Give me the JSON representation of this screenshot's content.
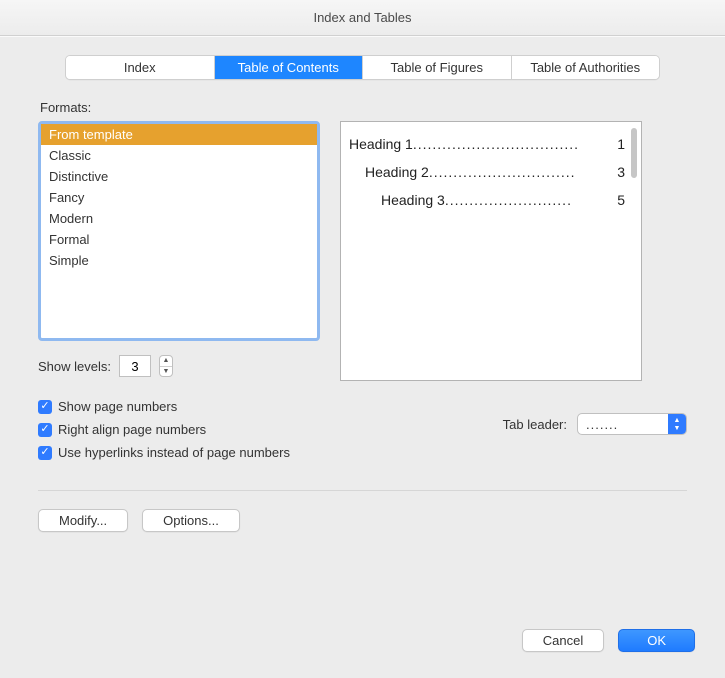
{
  "window": {
    "title": "Index and Tables"
  },
  "tabs": [
    {
      "label": "Index",
      "active": false
    },
    {
      "label": "Table of Contents",
      "active": true
    },
    {
      "label": "Table of Figures",
      "active": false
    },
    {
      "label": "Table of Authorities",
      "active": false
    }
  ],
  "formats": {
    "label": "Formats:",
    "items": [
      {
        "label": "From template",
        "selected": true
      },
      {
        "label": "Classic",
        "selected": false
      },
      {
        "label": "Distinctive",
        "selected": false
      },
      {
        "label": "Fancy",
        "selected": false
      },
      {
        "label": "Modern",
        "selected": false
      },
      {
        "label": "Formal",
        "selected": false
      },
      {
        "label": "Simple",
        "selected": false
      }
    ]
  },
  "preview": {
    "entries": [
      {
        "label": "Heading 1",
        "indent": 0,
        "page": "1"
      },
      {
        "label": "Heading 2",
        "indent": 1,
        "page": "3"
      },
      {
        "label": "Heading 3",
        "indent": 2,
        "page": "5"
      }
    ]
  },
  "show_levels": {
    "label": "Show levels:",
    "value": "3"
  },
  "checks": {
    "show_page_numbers": "Show page numbers",
    "right_align": "Right align page numbers",
    "hyperlinks": "Use hyperlinks instead of page numbers"
  },
  "tab_leader": {
    "label": "Tab leader:",
    "value": "......."
  },
  "buttons": {
    "modify": "Modify...",
    "options": "Options...",
    "cancel": "Cancel",
    "ok": "OK"
  }
}
